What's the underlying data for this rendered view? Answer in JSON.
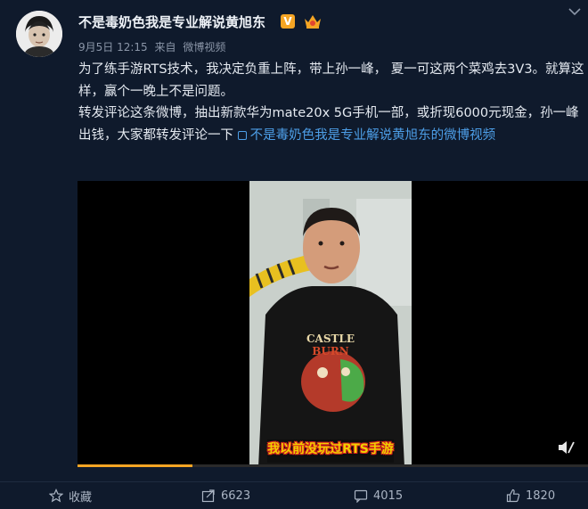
{
  "post": {
    "username": "不是毒奶色我是专业解说黄旭东",
    "verified_badge": "V",
    "time": "9月5日 12:15",
    "source_prefix": "来自",
    "source": "微博视频",
    "text_line1": "为了练手游RTS技术，我决定负重上阵，带上孙一峰， 夏一可这两个菜鸡去3V3。就算这样，赢个一晚上不是问题。",
    "text_line2": "转发评论这条微博，抽出新款华为mate20x 5G手机一部，或折现6000元现金，孙一峰出钱，大家都转发评论一下",
    "video_link_label": "不是毒奶色我是专业解说黄旭东的微博视频"
  },
  "video": {
    "subtitle": "我以前没玩过RTS手游",
    "shirt_text_top": "CASTLE",
    "shirt_text_bottom": "BURN",
    "progress": 0.225
  },
  "actions": {
    "favorite_label": "收藏",
    "repost_count": "6623",
    "comment_count": "4015",
    "like_count": "1820"
  },
  "colors": {
    "background": "#0f1a2c",
    "link": "#4d9fe8",
    "accent": "#f5a524"
  },
  "icons": [
    "avatar",
    "verified-v-icon",
    "crown-badge-icon",
    "chevron-down-icon",
    "video-play-icon",
    "mute-icon",
    "star-icon",
    "repost-icon",
    "comment-icon",
    "like-icon"
  ]
}
